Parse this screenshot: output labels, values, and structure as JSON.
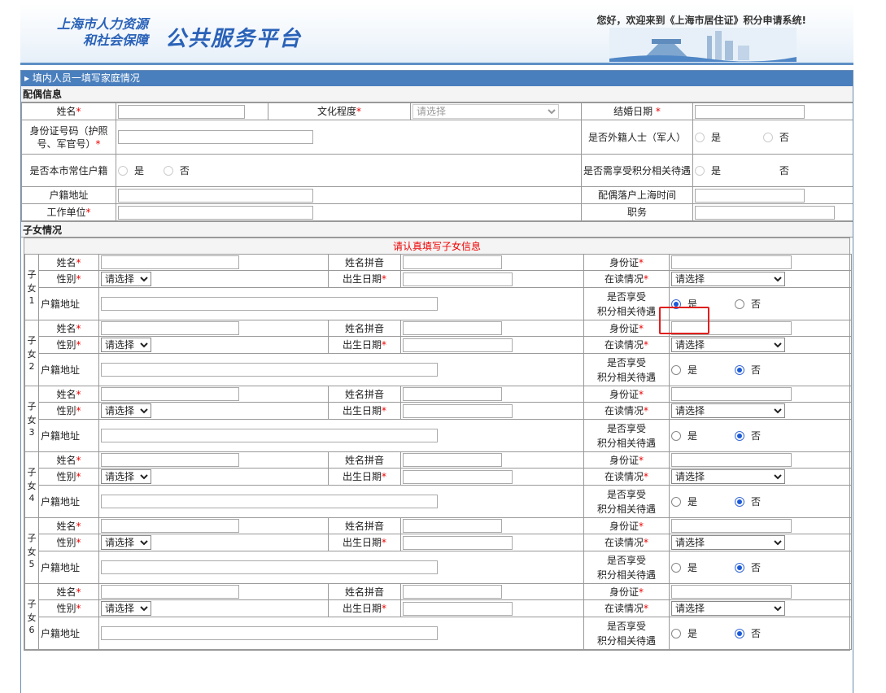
{
  "header": {
    "logo_line1": "上海市人力资源",
    "logo_line2": "和社会保障",
    "logo_main": "公共服务平台",
    "welcome": "您好，欢迎来到《上海市居住证》积分申请系统!"
  },
  "main": {
    "title": "填内人员一填写家庭情况"
  },
  "spouse": {
    "section_title": "配偶信息",
    "name_label": "姓名",
    "education_label": "文化程度",
    "education_select": "请选择",
    "marriage_date_label": "结婚日期 ",
    "id_label": "身份证号码（护照号、军官号）",
    "foreign_label": "是否外籍人士（军人）",
    "local_label": "是否本市常住户籍",
    "benefit_label": "是否需享受积分相关待遇",
    "hukou_label": "户籍地址",
    "settle_label": "配偶落户上海时间",
    "work_label": "工作单位",
    "position_label": "职务",
    "yes": "是",
    "no": "否",
    "required_mark": "*"
  },
  "children": {
    "section_title": "子女情况",
    "notice": "请认真填写子女信息",
    "labels": {
      "child": "子女",
      "name": "姓名",
      "pinyin": "姓名拼音",
      "id": "身份证",
      "gender": "性别",
      "birth": "出生日期",
      "study": "在读情况",
      "hukou": "户籍地址",
      "benefit_line1": "是否享受",
      "benefit_line2": "积分相关待遇",
      "yes": "是",
      "no": "否",
      "required_mark": "*"
    },
    "gender_select": "请选择",
    "study_select": "请选择",
    "items": [
      {
        "number": "1",
        "benefit": "yes"
      },
      {
        "number": "2",
        "benefit": "no"
      },
      {
        "number": "3",
        "benefit": "no"
      },
      {
        "number": "4",
        "benefit": "no"
      },
      {
        "number": "5",
        "benefit": "no"
      },
      {
        "number": "6",
        "benefit": "no"
      }
    ]
  }
}
